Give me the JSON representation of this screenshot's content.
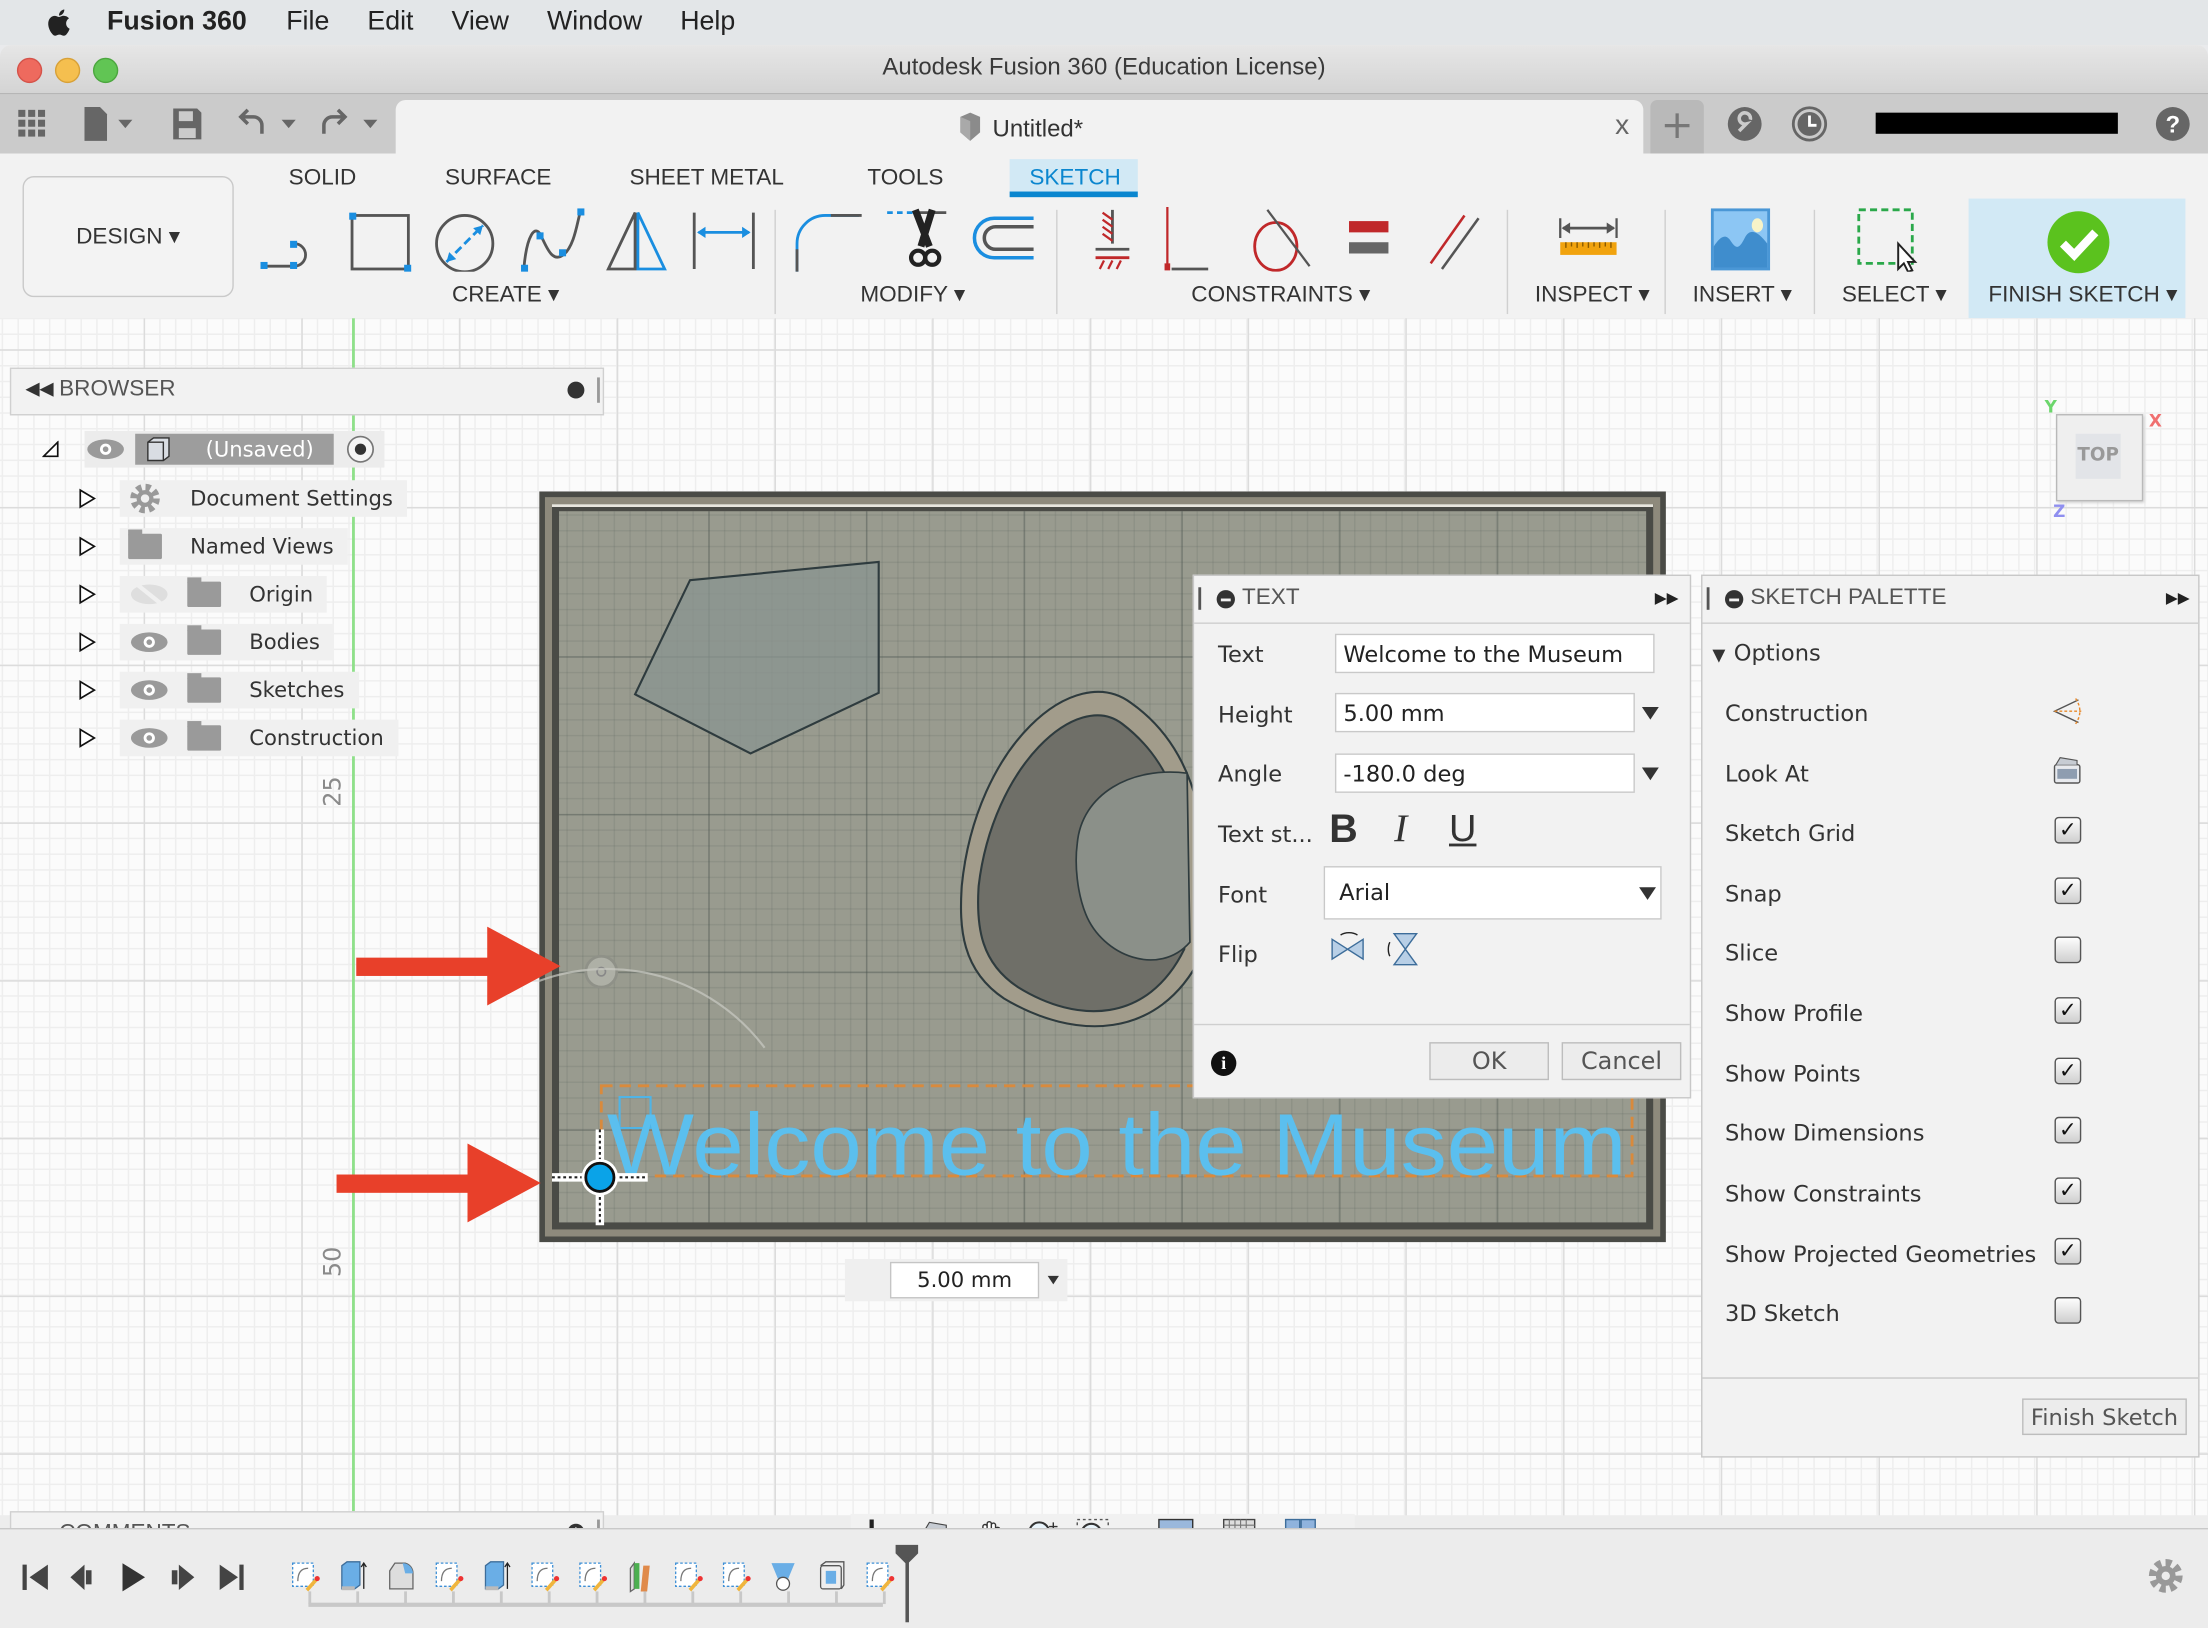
{
  "menubar": {
    "app": "Fusion 360",
    "items": [
      "File",
      "Edit",
      "View",
      "Window",
      "Help"
    ]
  },
  "window": {
    "title": "Autodesk Fusion 360 (Education License)"
  },
  "tabs": {
    "document_title": "Untitled*",
    "close": "x",
    "new_tab": "+",
    "user_name": "[redacted]"
  },
  "ribbon": {
    "workspace": "DESIGN ▾",
    "tabs": [
      {
        "label": "SOLID",
        "active": false
      },
      {
        "label": "SURFACE",
        "active": false
      },
      {
        "label": "SHEET METAL",
        "active": false
      },
      {
        "label": "TOOLS",
        "active": false
      },
      {
        "label": "SKETCH",
        "active": true
      }
    ],
    "groups": {
      "create": "CREATE ▾",
      "modify": "MODIFY ▾",
      "constraints": "CONSTRAINTS ▾",
      "inspect": "INSPECT ▾",
      "insert": "INSERT ▾",
      "select": "SELECT ▾",
      "finish": "FINISH SKETCH ▾"
    },
    "create_tools": [
      "line-icon",
      "rectangle-icon",
      "circle-icon",
      "spline-icon",
      "mirror-icon",
      "dimension-icon"
    ],
    "modify_tools": [
      "fillet-icon",
      "trim-icon",
      "offset-icon"
    ],
    "constraint_tools": [
      "fix-icon",
      "coincident-perpendicular-icon",
      "tangent-icon",
      "equal-icon",
      "parallel-icon"
    ]
  },
  "browser": {
    "title": "BROWSER",
    "root": "(Unsaved)",
    "items": [
      {
        "label": "Document Settings",
        "icon": "gear-icon",
        "visible": null
      },
      {
        "label": "Named Views",
        "icon": "folder-icon",
        "visible": null
      },
      {
        "label": "Origin",
        "icon": "folder-icon",
        "visible": false
      },
      {
        "label": "Bodies",
        "icon": "folder-icon",
        "visible": true
      },
      {
        "label": "Sketches",
        "icon": "folder-icon",
        "visible": true
      },
      {
        "label": "Construction",
        "icon": "folder-icon",
        "visible": true
      }
    ]
  },
  "comments": {
    "title": "COMMENTS"
  },
  "viewport": {
    "ruler_labels": [
      "25",
      "50"
    ],
    "sketch_text": "Welcome to the Museum",
    "dimension_input": "5.00 mm",
    "viewcube": {
      "face": "TOP",
      "x": "X",
      "y": "Y",
      "z": "Z"
    },
    "colors": {
      "sketch_text": "#5bbfee",
      "arrow": "#e8402a",
      "plate": "#999b8f"
    }
  },
  "text_dialog": {
    "title": "TEXT",
    "fields": {
      "text": {
        "label": "Text",
        "value": "Welcome to the Museum"
      },
      "height": {
        "label": "Height",
        "value": "5.00 mm"
      },
      "angle": {
        "label": "Angle",
        "value": "-180.0 deg"
      },
      "style": {
        "label": "Text st...",
        "bold": "B",
        "italic": "I",
        "underline": "U"
      },
      "font": {
        "label": "Font",
        "value": "Arial"
      },
      "flip": {
        "label": "Flip"
      }
    },
    "ok": "OK",
    "cancel": "Cancel"
  },
  "sketch_palette": {
    "title": "SKETCH PALETTE",
    "section": "Options",
    "options": [
      {
        "label": "Construction",
        "type": "icon",
        "icon": "construction-icon"
      },
      {
        "label": "Look At",
        "type": "icon",
        "icon": "look-at-icon"
      },
      {
        "label": "Sketch Grid",
        "type": "checkbox",
        "checked": true
      },
      {
        "label": "Snap",
        "type": "checkbox",
        "checked": true
      },
      {
        "label": "Slice",
        "type": "checkbox",
        "checked": false
      },
      {
        "label": "Show Profile",
        "type": "checkbox",
        "checked": true
      },
      {
        "label": "Show Points",
        "type": "checkbox",
        "checked": true
      },
      {
        "label": "Show Dimensions",
        "type": "checkbox",
        "checked": true
      },
      {
        "label": "Show Constraints",
        "type": "checkbox",
        "checked": true
      },
      {
        "label": "Show Projected Geometries",
        "type": "checkbox",
        "checked": true
      },
      {
        "label": "3D Sketch",
        "type": "checkbox",
        "checked": false
      }
    ],
    "finish_button": "Finish Sketch"
  },
  "nav_toolbar": [
    "orbit-icon",
    "look-at-icon",
    "pan-icon",
    "zoom-icon",
    "fit-icon",
    "display-settings-icon",
    "grid-settings-icon",
    "viewports-icon"
  ],
  "timeline": {
    "controls": [
      "first",
      "previous",
      "play",
      "next",
      "last"
    ],
    "features": [
      "sketch",
      "extrude",
      "fillet",
      "sketch",
      "extrude",
      "sketch",
      "sketch",
      "split",
      "sketch",
      "sketch",
      "loft",
      "shell",
      "sketch"
    ]
  }
}
